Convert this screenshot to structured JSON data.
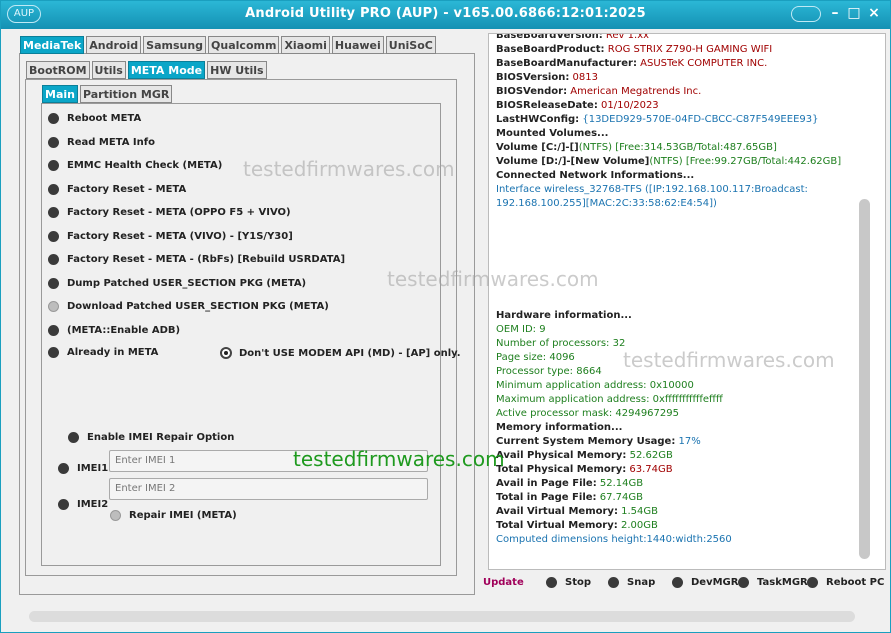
{
  "window": {
    "title": "Android Utility PRO (AUP) - v165.00.6866:12:01:2025",
    "logo": "AUP",
    "minimize": "–",
    "maximize": "□",
    "close": "×"
  },
  "brand_tabs": [
    "MediaTek",
    "Android",
    "Samsung",
    "Qualcomm",
    "Xiaomi",
    "Huawei",
    "UniSoC"
  ],
  "mode_tabs": [
    "BootROM",
    "Utils",
    "META Mode",
    "HW Utils"
  ],
  "sub_tabs": [
    "Main",
    "Partition MGR"
  ],
  "meta_items": [
    "Reboot META",
    "Read META Info",
    "EMMC Health Check (META)",
    "Factory Reset - META",
    "Factory Reset - META (OPPO F5 + VIVO)",
    "Factory Reset - META (VIVO) - [Y1S/Y30]",
    "Factory Reset - META - (RbFs) [Rebuild USRDATA]",
    "Dump Patched USER_SECTION PKG (META)",
    "Download Patched USER_SECTION PKG (META)",
    "(META::Enable ADB)",
    "Already in META"
  ],
  "modem_option": "Don't USE MODEM API (MD) - [AP] only.",
  "imei": {
    "enable_label": "Enable IMEI Repair Option",
    "imei1_label": "IMEI1",
    "imei2_label": "IMEI2",
    "imei1_placeholder": "Enter IMEI 1",
    "imei2_placeholder": "Enter IMEI 2",
    "repair_label": "Repair IMEI (META)"
  },
  "watermarks": [
    "testedfirmwares.com",
    "testedfirmwares.com",
    "testedfirmwares.com",
    "testedfirmwares.com"
  ],
  "log": {
    "l0": {
      "k": "BaseBoardVersion:",
      "v": "Rev 1.xx"
    },
    "l1": {
      "k": "BaseBoardProduct:",
      "v": "ROG STRIX Z790-H GAMING WIFI"
    },
    "l2": {
      "k": "BaseBoardManufacturer:",
      "v": "ASUSTeK COMPUTER INC."
    },
    "l3": {
      "k": "BIOSVersion:",
      "v": "0813"
    },
    "l4": {
      "k": "BIOSVendor:",
      "v": "American Megatrends Inc."
    },
    "l5": {
      "k": "BIOSReleaseDate:",
      "v": "01/10/2023"
    },
    "l6": {
      "k": "LastHWConfig:",
      "v": "{13DED929-570E-04FD-CBCC-C87F549EEE93}"
    },
    "l7": {
      "k": "Mounted Volumes...",
      "v": ""
    },
    "l8": {
      "k": "Volume [C:/]-[]",
      "v": "(NTFS) [Free:314.53GB/Total:487.65GB]"
    },
    "l9": {
      "k": "Volume [D:/]-[New Volume]",
      "v": "(NTFS) [Free:99.27GB/Total:442.62GB]"
    },
    "l10": {
      "k": "Connected Network Informations...",
      "v": ""
    },
    "l11": {
      "k": "",
      "v": "Interface wireless_32768-TFS ([IP:192.168.100.117:Broadcast:"
    },
    "l12": {
      "k": "",
      "v": "192.168.100.255][MAC:2C:33:58:62:E4:54])"
    },
    "l13": {
      "k": "Hardware information...",
      "v": ""
    },
    "l14": {
      "k": "OEM ID:",
      "v": "9"
    },
    "l15": {
      "k": "Number of processors:",
      "v": "32"
    },
    "l16": {
      "k": "Page size:",
      "v": "4096"
    },
    "l17": {
      "k": "Processor type:",
      "v": "8664"
    },
    "l18": {
      "k": "Minimum application address:",
      "v": "0x10000"
    },
    "l19": {
      "k": "Maximum application address:",
      "v": "0xfffffffffffeffff"
    },
    "l20": {
      "k": "Active processor mask:",
      "v": "4294967295"
    },
    "l21": {
      "k": "Memory information...",
      "v": ""
    },
    "l22": {
      "k": "Current System Memory Usage:",
      "v": "17%"
    },
    "l23": {
      "k": "Avail Physical Memory:",
      "v": "52.62GB"
    },
    "l24": {
      "k": "Total Physical Memory:",
      "v": "63.74GB"
    },
    "l25": {
      "k": "Avail in Page File:",
      "v": "52.14GB"
    },
    "l26": {
      "k": "Total in Page File:",
      "v": "67.74GB"
    },
    "l27": {
      "k": "Avail Virtual Memory:",
      "v": "1.54GB"
    },
    "l28": {
      "k": "Total Virtual Memory:",
      "v": "2.00GB"
    },
    "l29": {
      "k": "",
      "v": "Computed dimensions height:1440:width:2560"
    }
  },
  "bottom": {
    "update": "Update",
    "stop": "Stop",
    "snap": "Snap",
    "devmgr": "DevMGR",
    "taskmgr": "TaskMGR",
    "reboot_pc": "Reboot PC"
  },
  "colors": {
    "accent": "#0aa6c8",
    "title_bar": "#1a9fbf",
    "update_link": "#a0005a"
  }
}
